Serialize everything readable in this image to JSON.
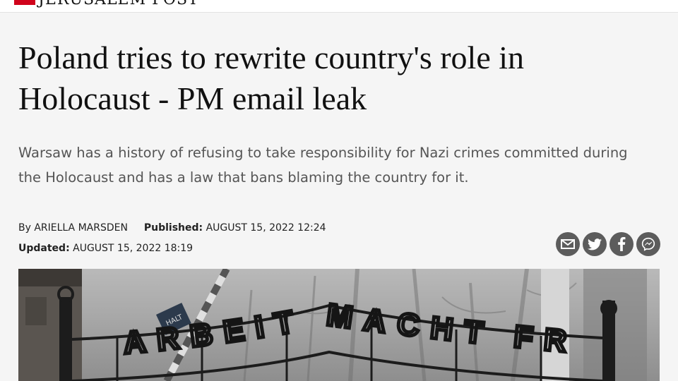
{
  "site": {
    "name": "JERUSALEM POST",
    "brand_color": "#d0021b"
  },
  "article": {
    "headline": "Poland tries to rewrite country's role in Holocaust - PM email leak",
    "subheadline": "Warsaw has a history of refusing to take responsibility for Nazi crimes committed during the Holocaust and has a law that bans blaming the country for it.",
    "byline_prefix": "By",
    "author": "ARIELLA MARSDEN",
    "published_label": "Published:",
    "published_value": "AUGUST 15, 2022 12:24",
    "updated_label": "Updated:",
    "updated_value": "AUGUST 15, 2022 18:19"
  },
  "share": {
    "buttons": [
      {
        "icon": "email-icon"
      },
      {
        "icon": "twitter-icon"
      },
      {
        "icon": "facebook-icon"
      },
      {
        "icon": "messenger-icon"
      }
    ],
    "color": "#5c5c5c"
  },
  "hero_image": {
    "sign_text": "ARBEIT MACHT FREI",
    "small_sign_text": "HALT"
  }
}
